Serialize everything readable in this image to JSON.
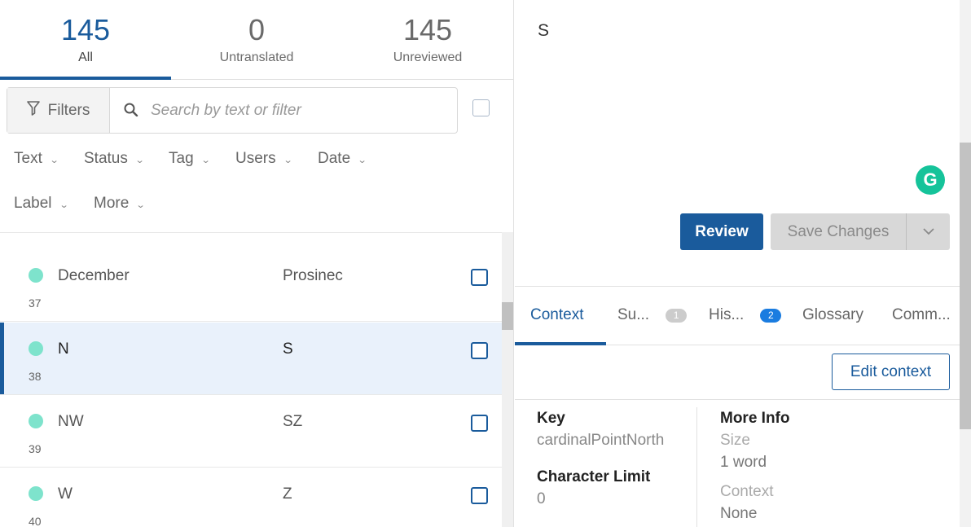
{
  "count_tabs": [
    {
      "count": "145",
      "label": "All"
    },
    {
      "count": "0",
      "label": "Untranslated"
    },
    {
      "count": "145",
      "label": "Unreviewed"
    }
  ],
  "filters_label": "Filters",
  "search": {
    "placeholder": "Search by text or filter"
  },
  "dropdowns": [
    "Text",
    "Status",
    "Tag",
    "Users",
    "Date",
    "Label",
    "More"
  ],
  "rows": [
    {
      "source": "December",
      "target": "Prosinec",
      "number": "37"
    },
    {
      "source": "N",
      "target": "S",
      "number": "38"
    },
    {
      "source": "NW",
      "target": "SZ",
      "number": "39"
    },
    {
      "source": "W",
      "target": "Z",
      "number": "40"
    }
  ],
  "editor": {
    "text": "S",
    "grammarly_letter": "G",
    "review_label": "Review",
    "save_label": "Save Changes"
  },
  "context_tabs": [
    {
      "label": "Context"
    },
    {
      "label": "Su...",
      "badge": "1"
    },
    {
      "label": "His...",
      "badge": "2"
    },
    {
      "label": "Glossary"
    },
    {
      "label": "Comm..."
    }
  ],
  "edit_context_label": "Edit context",
  "info": {
    "key_label": "Key",
    "key_value": "cardinalPointNorth",
    "char_limit_label": "Character Limit",
    "char_limit_value": "0",
    "more_info_label": "More Info",
    "size_label": "Size",
    "size_value": "1 word",
    "context_label": "Context",
    "context_value": "None"
  },
  "colors": {
    "accent": "#1a5b9c",
    "status_dot": "#7ee3cc",
    "selected_row": "#e9f1fb",
    "grammarly": "#15c39a"
  }
}
